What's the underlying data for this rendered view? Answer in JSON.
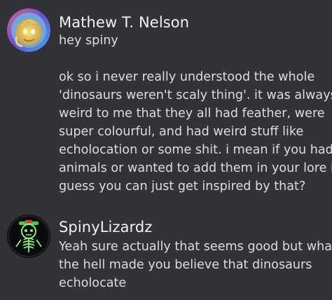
{
  "messages": [
    {
      "author": "Mathew T. Nelson",
      "avatar_icon": "golden-dragon-avatar-icon",
      "lines": [
        "hey spiny",
        "",
        "ok so i never really understood the whole",
        "'dinosaurs weren't scaly thing'. it was always",
        "weird to me that they all had feather, were",
        "super colourful, and had weird stuff like",
        "echolocation or some shit. i mean if you had",
        "animals or wanted to add them in your lore i",
        "guess you can just get inspired by that?"
      ]
    },
    {
      "author": "SpinyLizardz",
      "avatar_icon": "green-skeleton-avatar-icon",
      "lines": [
        "Yeah sure actually that seems good but what",
        "the hell made you believe that dinosaurs",
        "echolocate"
      ]
    }
  ],
  "colors": {
    "background": "#323339",
    "username": "#f2f3f5",
    "message_text": "#dbdee1"
  }
}
